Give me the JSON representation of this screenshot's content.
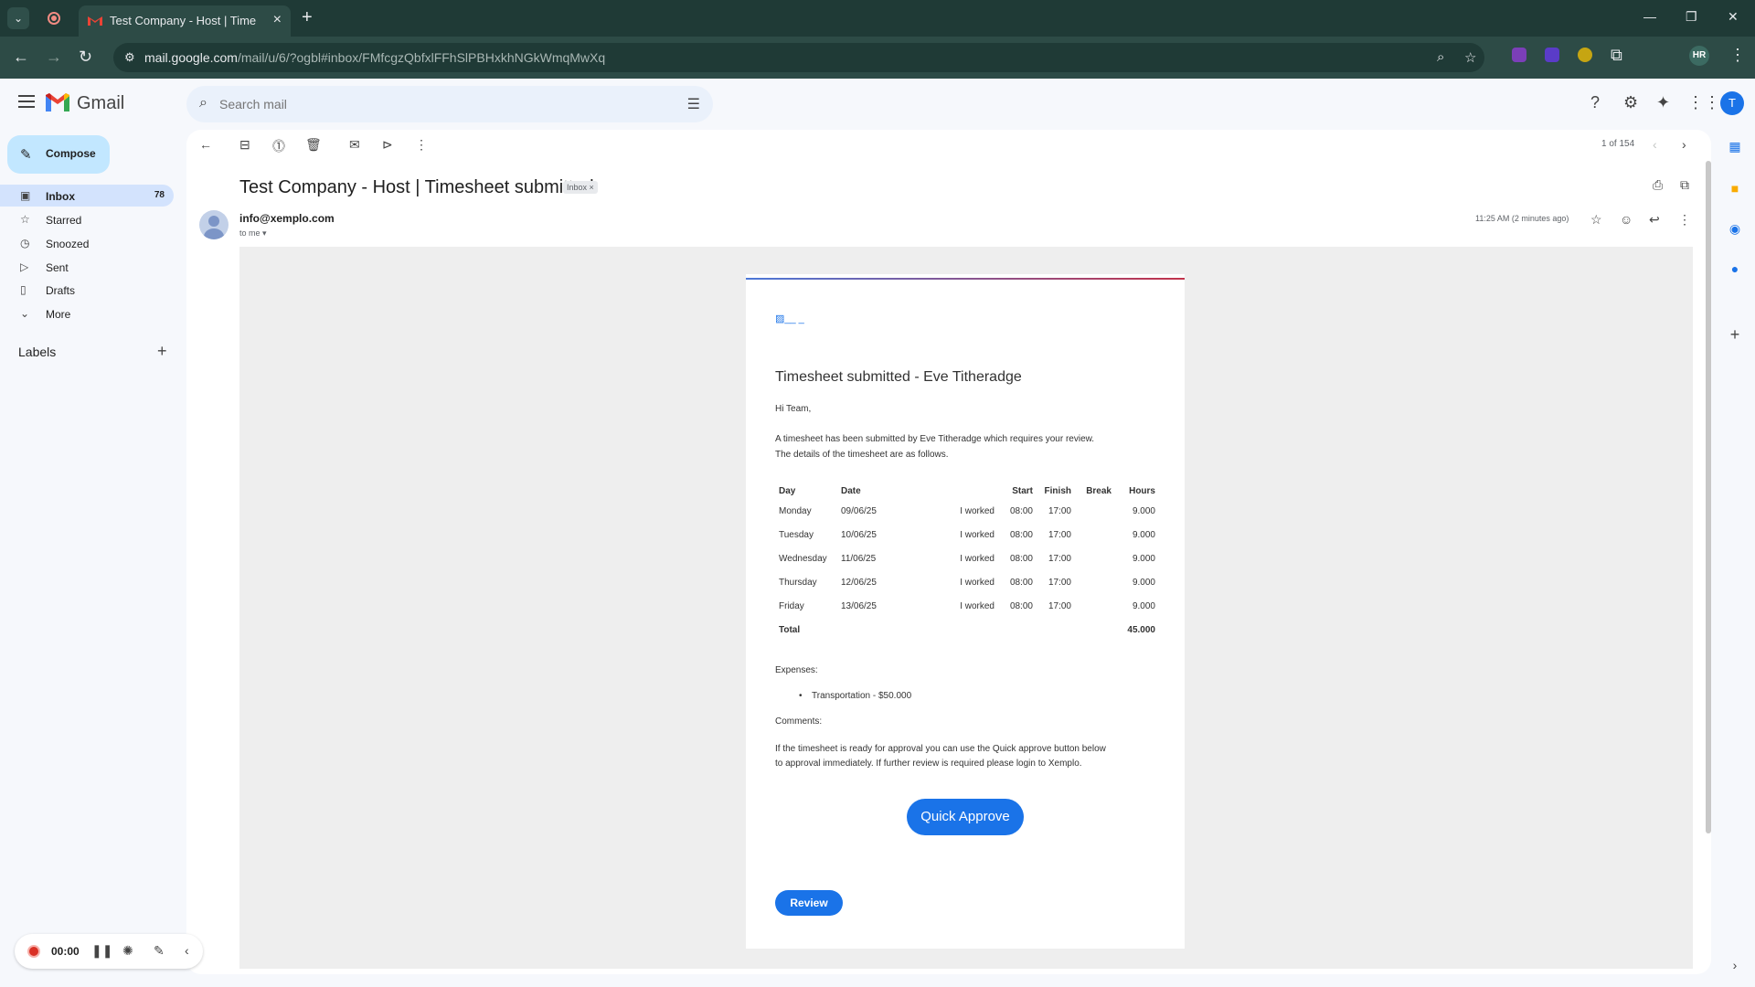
{
  "browser": {
    "tab_title": "Test Company - Host | Timeshe…",
    "url_host": "mail.google.com",
    "url_path": "/mail/u/6/?ogbl#inbox/FMfcgzQbfxlFFhSlPBHxkhNGkWmqMwXq",
    "profile_initials": "HR"
  },
  "gmail": {
    "app_name": "Gmail",
    "search_placeholder": "Search mail",
    "account_initial": "T"
  },
  "sidebar": {
    "compose_label": "Compose",
    "items": [
      {
        "label": "Inbox",
        "count": "78"
      },
      {
        "label": "Starred",
        "count": ""
      },
      {
        "label": "Snoozed",
        "count": ""
      },
      {
        "label": "Sent",
        "count": ""
      },
      {
        "label": "Drafts",
        "count": ""
      },
      {
        "label": "More",
        "count": ""
      }
    ],
    "labels_title": "Labels"
  },
  "toolbar": {
    "pager": "1 of 154"
  },
  "message": {
    "subject": "Test Company - Host | Timesheet submitted",
    "chip": "Inbox ×",
    "sender": "info@xemplo.com",
    "to": "to me ▾",
    "time": "11:25 AM (2 minutes ago)"
  },
  "email": {
    "title": "Timesheet submitted - Eve Titheradge",
    "greeting": "Hi Team,",
    "intro_line1": "A timesheet has been submitted by Eve Titheradge which requires your review.",
    "intro_line2": "The details of the timesheet are as follows.",
    "table_headers": [
      "Day",
      "Date",
      "",
      "Start",
      "Finish",
      "Break",
      "Hours"
    ],
    "rows": [
      {
        "day": "Monday",
        "date": "09/06/25",
        "type": "I worked",
        "start": "08:00",
        "finish": "17:00",
        "break": "",
        "hours": "9.000"
      },
      {
        "day": "Tuesday",
        "date": "10/06/25",
        "type": "I worked",
        "start": "08:00",
        "finish": "17:00",
        "break": "",
        "hours": "9.000"
      },
      {
        "day": "Wednesday",
        "date": "11/06/25",
        "type": "I worked",
        "start": "08:00",
        "finish": "17:00",
        "break": "",
        "hours": "9.000"
      },
      {
        "day": "Thursday",
        "date": "12/06/25",
        "type": "I worked",
        "start": "08:00",
        "finish": "17:00",
        "break": "",
        "hours": "9.000"
      },
      {
        "day": "Friday",
        "date": "13/06/25",
        "type": "I worked",
        "start": "08:00",
        "finish": "17:00",
        "break": "",
        "hours": "9.000"
      }
    ],
    "total_label": "Total",
    "total_hours": "45.000",
    "expenses_label": "Expenses:",
    "expense_item": "Transportation - $50.000",
    "comments_label": "Comments:",
    "footer_line1": "If the timesheet is ready for approval you can use the Quick approve button below",
    "footer_line2": "to approval immediately. If further review is required please login to Xemplo.",
    "quick_approve_label": "Quick Approve",
    "review_label": "Review"
  },
  "recorder": {
    "time": "00:00"
  },
  "colors": {
    "accent": "#1a73e8",
    "compose_bg": "#c2e7ff",
    "active_nav": "#d3e3fd",
    "chrome_bg": "#1f3a36"
  }
}
